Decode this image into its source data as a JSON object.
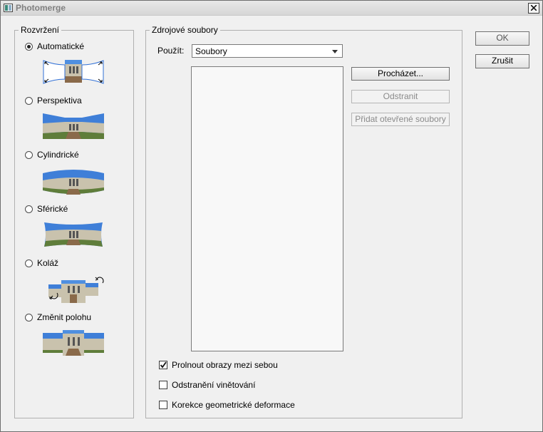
{
  "window": {
    "title": "Photomerge"
  },
  "layout_group": {
    "legend": "Rozvržení",
    "options": [
      {
        "label": "Automatické",
        "selected": true
      },
      {
        "label": "Perspektiva",
        "selected": false
      },
      {
        "label": "Cylindrické",
        "selected": false
      },
      {
        "label": "Sférické",
        "selected": false
      },
      {
        "label": "Koláž",
        "selected": false
      },
      {
        "label": "Změnit polohu",
        "selected": false
      }
    ]
  },
  "source_group": {
    "legend": "Zdrojové soubory",
    "use_label": "Použít:",
    "use_value": "Soubory",
    "browse_label": "Procházet...",
    "remove_label": "Odstranit",
    "add_open_label": "Přidat otevřené soubory"
  },
  "checkboxes": [
    {
      "label": "Prolnout obrazy mezi sebou",
      "checked": true
    },
    {
      "label": "Odstranění vinětování",
      "checked": false
    },
    {
      "label": "Korekce geometrické deformace",
      "checked": false
    }
  ],
  "buttons": {
    "ok": "OK",
    "cancel": "Zrušit"
  },
  "colors": {
    "sky": "#3f7fd8",
    "building": "#c9c2ad",
    "ground": "#8a6a4a",
    "grass": "#5f7d3a",
    "selection": "#2f6fd6"
  }
}
